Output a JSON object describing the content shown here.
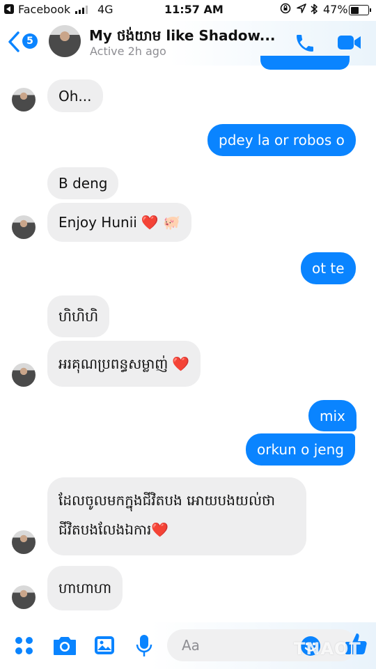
{
  "status_bar": {
    "carrier": "Facebook",
    "network": "4G",
    "time": "11:57 AM",
    "battery_percent": "47%",
    "battery_level": 0.47
  },
  "header": {
    "back_count": "5",
    "contact_name": "My ថង់យាម like Shadow...",
    "contact_status": "Active 2h ago",
    "icons": [
      "back-chevron-icon",
      "phone-icon",
      "video-camera-icon"
    ]
  },
  "messages": [
    {
      "side": "in",
      "text": "Oh..."
    },
    {
      "side": "out",
      "text": "pdey la or robos o"
    },
    {
      "side": "in",
      "text": "B deng"
    },
    {
      "side": "in",
      "text": "Enjoy Hunii ",
      "emoji": "❤️ 🐖"
    },
    {
      "side": "out",
      "text": "ot te"
    },
    {
      "side": "in",
      "text": "ហិហិហិ"
    },
    {
      "side": "in",
      "text": "អរគុណប្រពន្ធសម្លាញ់ ",
      "emoji": "❤️"
    },
    {
      "side": "out",
      "text": "mix"
    },
    {
      "side": "out",
      "text": "orkun o jeng"
    },
    {
      "side": "in",
      "text": "ដែលចូលមកក្នុងជីវិតបង អោយបងយល់ថា",
      "text2": "ជីវិតបងលែងឯការ",
      "emoji": "❤️"
    },
    {
      "side": "in",
      "text": "ហាហាហា"
    }
  ],
  "composer": {
    "placeholder": "Aa",
    "icons": [
      "apps-icon",
      "camera-icon",
      "photo-icon",
      "microphone-icon",
      "emoji-icon",
      "thumbs-up-icon"
    ]
  },
  "watermark": "TNAOT",
  "colors": {
    "accent": "#0a84ff",
    "incoming_bubble": "#eeeeef"
  }
}
